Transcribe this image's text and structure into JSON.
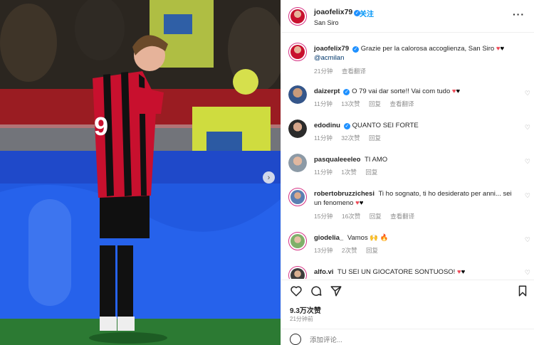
{
  "post": {
    "author": "joaofelix79",
    "follow_label": "关注",
    "location": "San Siro",
    "more_label": "···",
    "caption": {
      "username": "joaofelix79",
      "text": "Grazie per la calorosa accoglienza, San Siro",
      "mention": "@acmilan",
      "time": "21分钟",
      "translate": "查看翻译"
    },
    "likes": "9.3万次赞",
    "posted": "21分钟前",
    "comment_placeholder": "添加评论..."
  },
  "comments": [
    {
      "username": "daizerpt",
      "verified": true,
      "text": "O 79 vai dar sorte!! Vai com tudo",
      "hearts": [
        "red",
        "black"
      ],
      "time": "11分钟",
      "likes": "13次赞",
      "reply": "回复",
      "translate": "查看翻译"
    },
    {
      "username": "edodinu",
      "verified": true,
      "text": "QUANTO SEI FORTE",
      "hearts": [],
      "time": "11分钟",
      "likes": "32次赞",
      "reply": "回复",
      "translate": ""
    },
    {
      "username": "pasqualeeeleo",
      "verified": false,
      "text": "TI AMO",
      "hearts": [],
      "time": "11分钟",
      "likes": "1次赞",
      "reply": "回复",
      "translate": ""
    },
    {
      "username": "robertobruzzichesi",
      "verified": false,
      "text": "Ti ho sognato, ti ho desiderato per anni... sei un fenomeno",
      "hearts": [
        "red",
        "black"
      ],
      "time": "15分钟",
      "likes": "16次赞",
      "reply": "回复",
      "translate": "查看翻译"
    },
    {
      "username": "giodelia_",
      "verified": false,
      "text": "Vamos 🙌 🔥",
      "hearts": [],
      "time": "13分钟",
      "likes": "2次赞",
      "reply": "回复",
      "translate": ""
    },
    {
      "username": "alfo.vi",
      "verified": false,
      "text": "TU SEI UN GIOCATORE SONTUOSO!",
      "hearts": [
        "red",
        "black"
      ],
      "time": "",
      "likes": "",
      "reply": "",
      "translate": ""
    }
  ],
  "icons": {
    "like": "heart-icon",
    "comment": "comment-bubble-icon",
    "share": "paper-plane-icon",
    "save": "bookmark-icon",
    "next": "chevron-right-icon",
    "emoji": "smiley-icon"
  },
  "colors": {
    "accent": "#0095f6",
    "verified": "#1e90ff",
    "jersey_red": "#c8102e"
  }
}
